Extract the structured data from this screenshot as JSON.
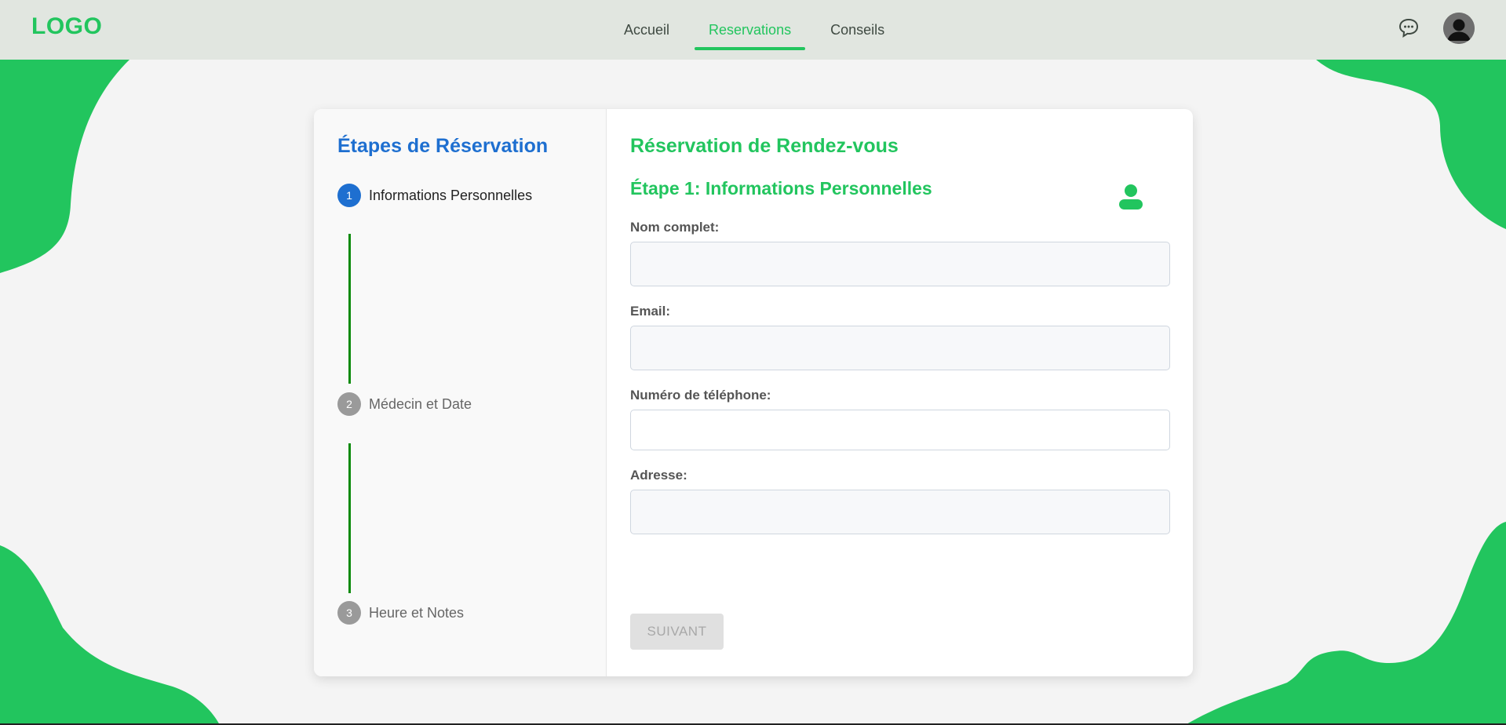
{
  "header": {
    "logo": "LOGO",
    "nav": [
      {
        "label": "Accueil",
        "active": false
      },
      {
        "label": "Reservations",
        "active": true
      },
      {
        "label": "Conseils",
        "active": false
      }
    ],
    "icons": {
      "chat": "chat-bubble-icon",
      "avatar": "user-avatar-icon"
    }
  },
  "steps_panel": {
    "title": "Étapes de Réservation",
    "steps": [
      {
        "number": "1",
        "label": "Informations Personnelles",
        "active": true
      },
      {
        "number": "2",
        "label": "Médecin et Date",
        "active": false
      },
      {
        "number": "3",
        "label": "Heure et Notes",
        "active": false
      }
    ]
  },
  "form": {
    "title": "Réservation de Rendez-vous",
    "subtitle": "Étape 1: Informations Personnelles",
    "icon": "user-icon",
    "fields": [
      {
        "label": "Nom complet:",
        "value": ""
      },
      {
        "label": "Email:",
        "value": ""
      },
      {
        "label": "Numéro de téléphone:",
        "value": ""
      },
      {
        "label": "Adresse:",
        "value": ""
      }
    ],
    "next_button": "SUIVANT"
  },
  "colors": {
    "brand_green": "#22c55e",
    "step_blue": "#1e6fd0",
    "step_line_green": "#0a8a0a",
    "topbar_bg": "#e1e6e0"
  }
}
